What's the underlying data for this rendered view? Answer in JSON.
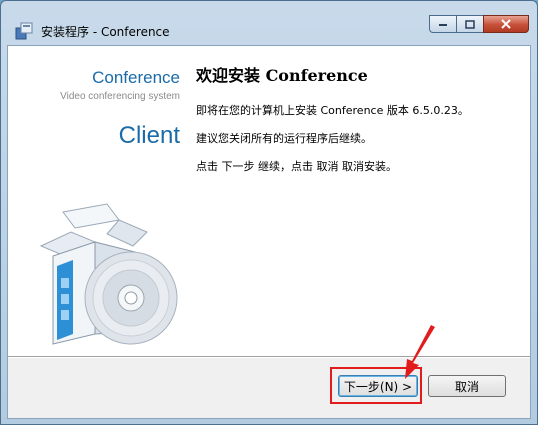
{
  "window": {
    "title": "安装程序 - Conference"
  },
  "brand": {
    "name": "Conference",
    "tagline": "Video conferencing system",
    "edition": "Client"
  },
  "content": {
    "welcome_title": "欢迎安装 Conference",
    "line1": "即将在您的计算机上安装 Conference 版本 6.5.0.23。",
    "line2": "建议您关闭所有的运行程序后继续。",
    "line3": "点击 下一步 继续，点击 取消 取消安装。"
  },
  "buttons": {
    "next_label": "下一步(N) >",
    "cancel_label": "取消"
  },
  "colors": {
    "brand_blue": "#1a6ba8",
    "annotation_red": "#e21c1c"
  }
}
